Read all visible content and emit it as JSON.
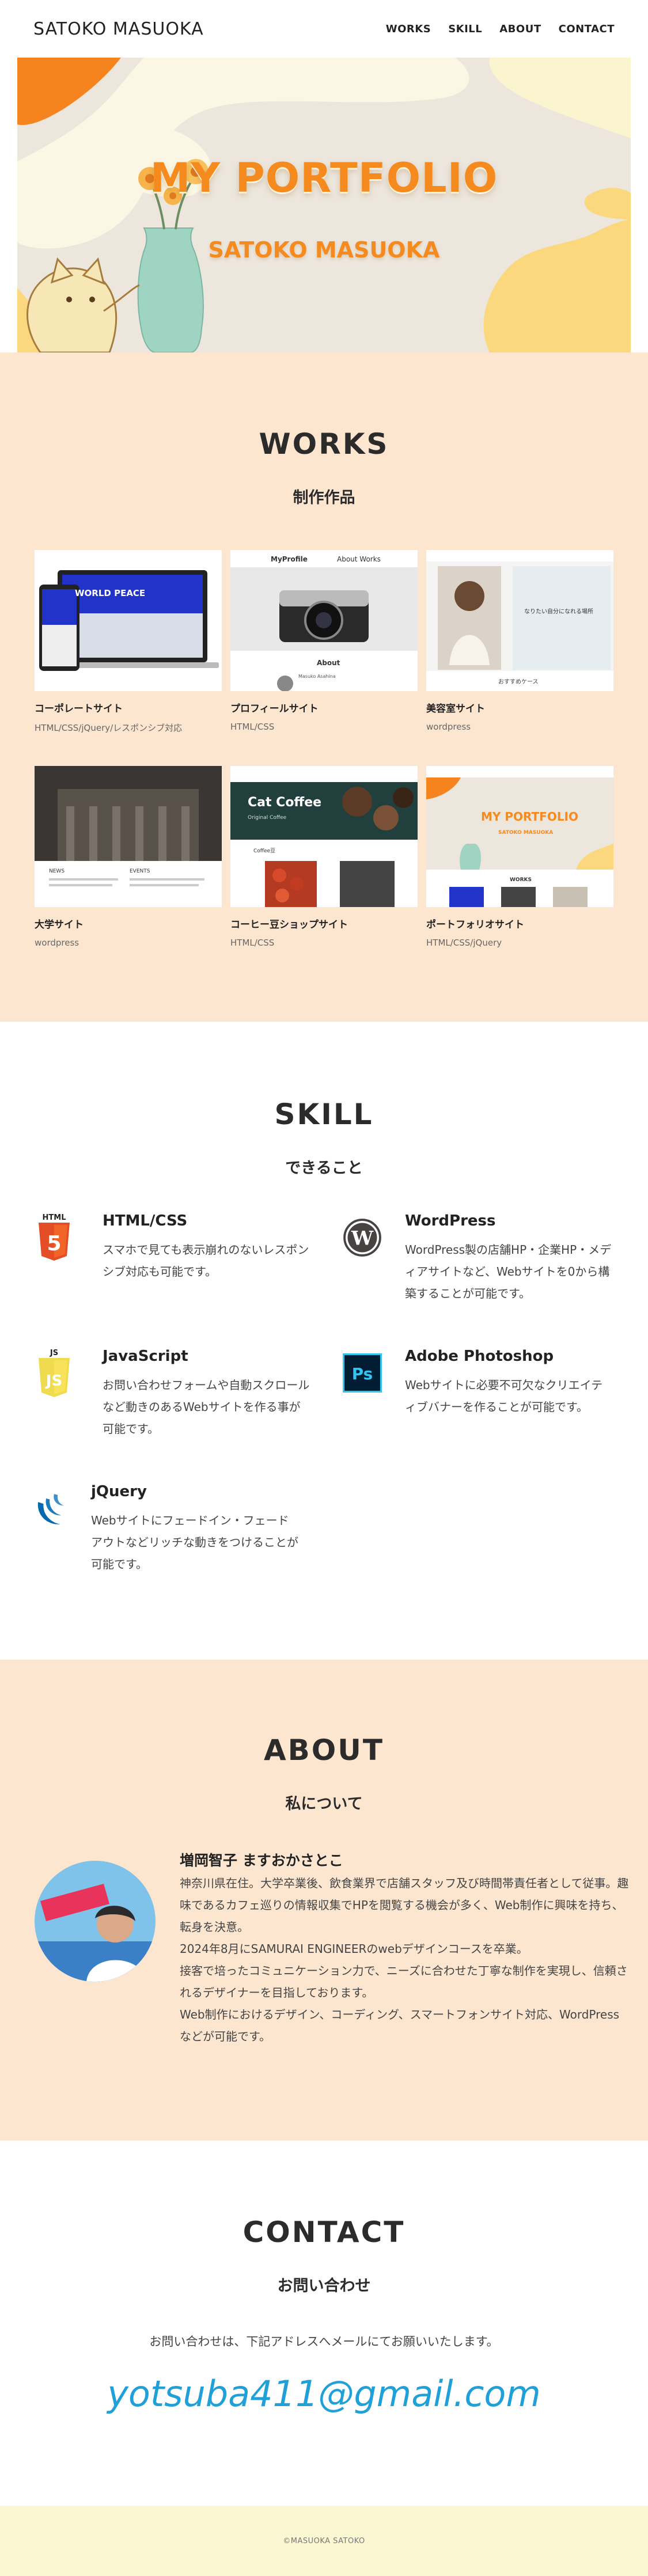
{
  "header": {
    "logo": "SATOKO MASUOKA",
    "nav": [
      "WORKS",
      "SKILL",
      "ABOUT",
      "CONTACT"
    ]
  },
  "hero": {
    "title": "MY PORTFOLIO",
    "subtitle": "SATOKO MASUOKA"
  },
  "works": {
    "title": "WORKS",
    "subtitle": "制作作品",
    "items": [
      {
        "title": "コーポレートサイト",
        "tags": "HTML/CSS/jQuery/レスポンシブ対応",
        "thumb_text": "WORLD PEACE"
      },
      {
        "title": "プロフィールサイト",
        "tags": "HTML/CSS",
        "thumb_text": "MyProfile",
        "thumb_nav": "About   Works",
        "thumb_about": "About",
        "thumb_person": "Masuko Asahina"
      },
      {
        "title": "美容室サイト",
        "tags": "wordpress",
        "thumb_text": "なりたい自分になれる場所",
        "thumb_caption": "おすすめケース"
      },
      {
        "title": "大学サイト",
        "tags": "wordpress",
        "thumb_text": "NEWS",
        "thumb_text2": "EVENTS"
      },
      {
        "title": "コーヒー豆ショップサイト",
        "tags": "HTML/CSS",
        "thumb_text": "Cat Coffee",
        "thumb_sub": "Original Coffee",
        "thumb_label": "Coffee豆"
      },
      {
        "title": "ポートフォリオサイト",
        "tags": "HTML/CSS/jQuery",
        "thumb_text": "MY PORTFOLIO",
        "thumb_sub": "SATOKO MASUOKA",
        "thumb_label": "WORKS"
      }
    ]
  },
  "skill": {
    "title": "SKILL",
    "subtitle": "できること",
    "items": [
      {
        "name": "HTML/CSS",
        "desc": "スマホで見ても表示崩れのないレスポンシブ対応も可能です。",
        "icon": "html5-icon"
      },
      {
        "name": "WordPress",
        "desc": "WordPress製の店舗HP・企業HP・メディアサイトなど、Webサイトを0から構築することが可能です。",
        "icon": "wordpress-icon"
      },
      {
        "name": "JavaScript",
        "desc": "お問い合わせフォームや自動スクロールなど動きのあるWebサイトを作る事が可能です。",
        "icon": "javascript-icon"
      },
      {
        "name": "Adobe Photoshop",
        "desc": "Webサイトに必要不可欠なクリエイティブバナーを作ることが可能です。",
        "icon": "photoshop-icon"
      },
      {
        "name": "jQuery",
        "desc": "Webサイトにフェードイン・フェードアウトなどリッチな動きをつけることが可能です。",
        "icon": "jquery-icon"
      }
    ],
    "icon_labels": {
      "html": "HTML",
      "js": "JS",
      "ps": "Ps"
    }
  },
  "about": {
    "title": "ABOUT",
    "subtitle": "私について",
    "name": "増岡智子 ますおかさとこ",
    "paragraphs": [
      "神奈川県在住。大学卒業後、飲食業界で店舗スタッフ及び時間帯責任者として従事。趣味であるカフェ巡りの情報収集でHPを閲覧する機会が多く、Web制作に興味を持ち、転身を決意。",
      "2024年8月にSAMURAI ENGINEERのwebデザインコースを卒業。",
      "接客で培ったコミュニケーション力で、ニーズに合わせた丁寧な制作を実現し、信頼されるデザイナーを目指しております。",
      "Web制作におけるデザイン、コーディング、スマートフォンサイト対応、WordPressなどが可能です。"
    ]
  },
  "contact": {
    "title": "CONTACT",
    "subtitle": "お問い合わせ",
    "message": "お問い合わせは、下記アドレスへメールにてお願いいたします。",
    "email": "yotsuba411@gmail.com"
  },
  "footer": {
    "copyright": "©MASUOKA SATOKO"
  },
  "colors": {
    "accent_orange": "#f58a1f",
    "peach_bg": "#fde6d0",
    "footer_bg": "#fbf7d3",
    "link_blue": "#1fa0d8"
  }
}
